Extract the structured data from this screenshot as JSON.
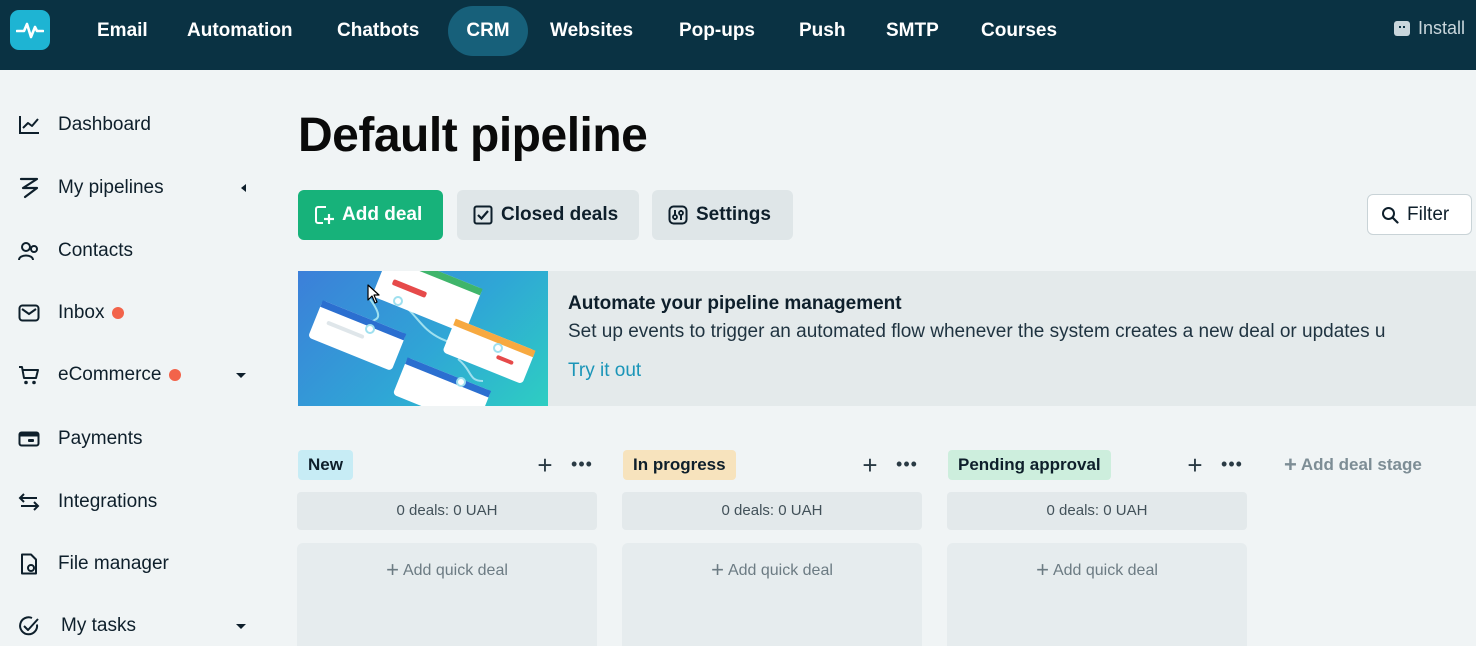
{
  "nav": {
    "items": [
      {
        "label": "Email"
      },
      {
        "label": "Automation"
      },
      {
        "label": "Chatbots"
      },
      {
        "label": "CRM",
        "active": true
      },
      {
        "label": "Websites"
      },
      {
        "label": "Pop-ups"
      },
      {
        "label": "Push"
      },
      {
        "label": "SMTP"
      },
      {
        "label": "Courses"
      }
    ],
    "install_label": "Install"
  },
  "sidebar": {
    "items": [
      {
        "label": "Dashboard",
        "icon": "chart-line-icon"
      },
      {
        "label": "My pipelines",
        "icon": "pipeline-icon",
        "expander": "left"
      },
      {
        "label": "Contacts",
        "icon": "contacts-icon"
      },
      {
        "label": "Inbox",
        "icon": "envelope-icon",
        "badge": true
      },
      {
        "label": "eCommerce",
        "icon": "cart-icon",
        "badge": true,
        "expander": "down"
      },
      {
        "label": "Payments",
        "icon": "wallet-icon"
      },
      {
        "label": "Integrations",
        "icon": "swap-arrows-icon"
      },
      {
        "label": "File manager",
        "icon": "file-icon"
      },
      {
        "label": "My tasks",
        "icon": "check-circle-icon",
        "expander": "down"
      }
    ]
  },
  "main": {
    "title": "Default pipeline",
    "buttons": {
      "add_deal": "Add deal",
      "closed_deals": "Closed deals",
      "settings": "Settings",
      "filter": "Filter"
    },
    "banner": {
      "title": "Automate your pipeline management",
      "text": "Set up events to trigger an automated flow whenever the system creates a new deal or updates u",
      "link": "Try it out"
    },
    "stages": [
      {
        "name": "New",
        "color": "#c7ecf5",
        "count": "0 deals: 0 UAH",
        "quick": "Add quick deal"
      },
      {
        "name": "In progress",
        "color": "#f7e3bd",
        "count": "0 deals: 0 UAH",
        "quick": "Add quick deal"
      },
      {
        "name": "Pending approval",
        "color": "#cdeedd",
        "count": "0 deals: 0 UAH",
        "quick": "Add quick deal"
      }
    ],
    "add_stage": "Add deal stage"
  },
  "colors": {
    "topbar": "#0a3243",
    "accent_green": "#17b27a",
    "link": "#1a95b8",
    "badge": "#f2634a"
  }
}
